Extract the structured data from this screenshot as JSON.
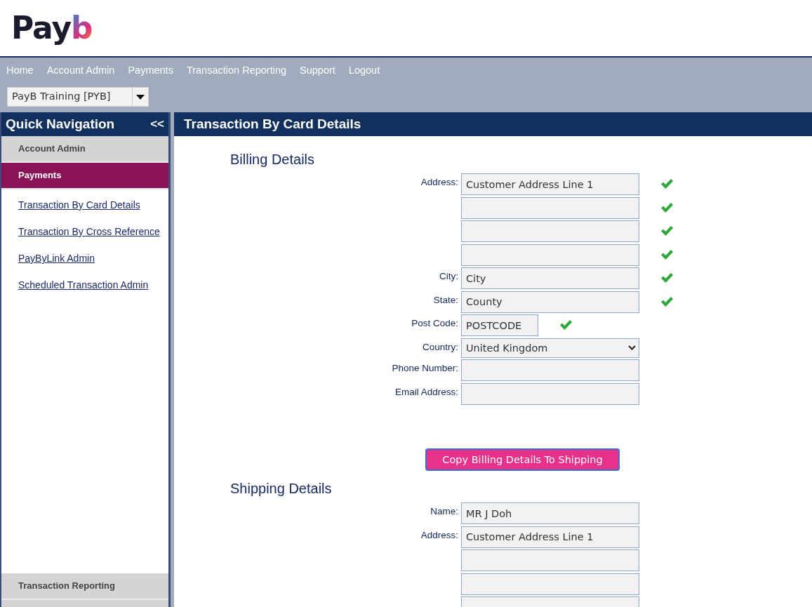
{
  "logo": {
    "text": "Pay",
    "mark": "b"
  },
  "menu": [
    "Home",
    "Account Admin",
    "Payments",
    "Transaction Reporting",
    "Support",
    "Logout"
  ],
  "account_select": {
    "value": "PayB Training [PYB]"
  },
  "sidebar": {
    "title": "Quick Navigation",
    "collapse": "<<",
    "sections": [
      {
        "label": "Account Admin",
        "selected": false
      },
      {
        "label": "Payments",
        "selected": true
      }
    ],
    "links": [
      "Transaction By Card Details",
      "Transaction By Cross Reference",
      "PayByLink Admin",
      "Scheduled Transaction Admin"
    ],
    "bottom_sections": [
      {
        "label": "Transaction Reporting",
        "selected": false
      }
    ]
  },
  "page_title": "Transaction By Card Details",
  "billing": {
    "heading": "Billing Details",
    "fields": [
      {
        "label": "Address:",
        "value": "Customer Address Line 1",
        "kind": "text",
        "valid": true
      },
      {
        "kind": "text",
        "valid": true
      },
      {
        "kind": "text",
        "valid": true
      },
      {
        "kind": "text",
        "valid": true
      },
      {
        "label": "City:",
        "value": "City",
        "kind": "text",
        "valid": true
      },
      {
        "label": "State:",
        "value": "County",
        "kind": "text",
        "valid": true
      },
      {
        "label": "Post Code:",
        "value": "POSTCODE",
        "kind": "short",
        "valid": true
      },
      {
        "label": "Country:",
        "value": "United Kingdom",
        "kind": "select"
      },
      {
        "label": "Phone Number:",
        "kind": "text"
      },
      {
        "label": "Email Address:",
        "kind": "text"
      }
    ]
  },
  "copy_button": "Copy Billing Details To Shipping",
  "shipping": {
    "heading": "Shipping Details",
    "fields": [
      {
        "label": "Name:",
        "value": "MR J Doh",
        "kind": "text"
      },
      {
        "label": "Address:",
        "value": "Customer Address Line 1",
        "kind": "text"
      },
      {
        "kind": "text"
      },
      {
        "kind": "text"
      },
      {
        "kind": "text"
      }
    ]
  }
}
